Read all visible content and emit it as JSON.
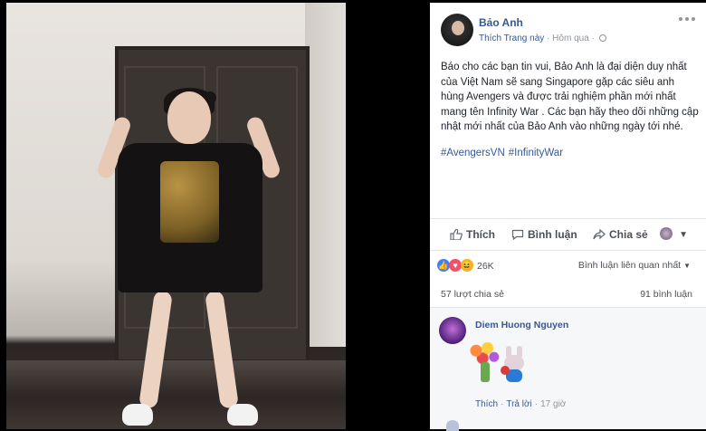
{
  "post": {
    "author": "Bảo Anh",
    "like_page": "Thích Trang này",
    "separator": "·",
    "time": "Hôm qua",
    "privacy_separator": "·",
    "text": "Báo cho các bạn tin vui, Bảo Anh là đại diện duy nhất của Việt Nam sẽ sang Singapore gặp các siêu anh hùng Avengers và được trải nghiệm phần mới nhất mang tên Infinity War . Các bạn hãy theo dõi những cập nhật mới nhất của Bảo Anh vào những ngày tới nhé.",
    "hashtags": [
      "#AvengersVN",
      "#InfinityWar"
    ]
  },
  "actions": {
    "like": "Thích",
    "comment": "Bình luận",
    "share": "Chia sẻ"
  },
  "reactions": {
    "count": "26K",
    "filter": "Bình luận liên quan nhất",
    "icons": [
      "like-icon",
      "love-icon",
      "haha-icon"
    ],
    "colors": {
      "like": "#4080ff",
      "love": "#f25268",
      "haha": "#f7b125"
    }
  },
  "counts": {
    "shares": "57 lượt chia sẻ",
    "comments": "91 bình luận"
  },
  "comment": {
    "author": "Diem Huong Nguyen",
    "like": "Thích",
    "reply": "Trả lời",
    "time": "17 giờ"
  },
  "colors": {
    "link": "#365899",
    "text": "#1d2129",
    "muted": "#90949c"
  }
}
